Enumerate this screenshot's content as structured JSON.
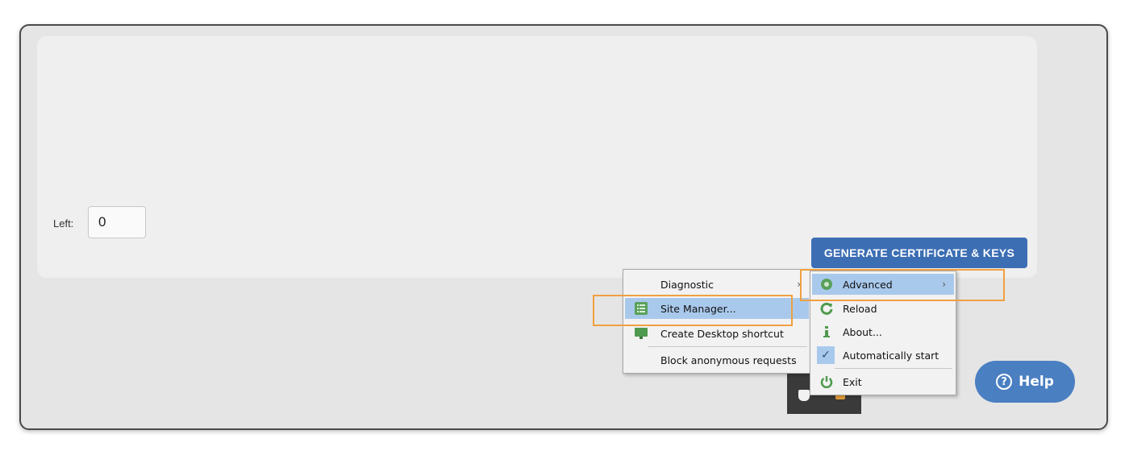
{
  "form": {
    "left_label": "Left:",
    "left_value": "0",
    "generate_button": "GENERATE CERTIFICATE & KEYS"
  },
  "help_button": {
    "icon": "question-circle-icon",
    "label": "Help"
  },
  "context_menu": {
    "items": [
      {
        "label": "Diagnostic",
        "has_submenu": true
      },
      {
        "label": "Site Manager...",
        "icon": "list-icon",
        "highlighted": true
      },
      {
        "label": "Create Desktop shortcut",
        "icon": "monitor-icon"
      },
      {
        "label": "Block anonymous requests"
      }
    ]
  },
  "submenu": {
    "items": [
      {
        "label": "Advanced",
        "icon": "gear-icon",
        "highlighted": true,
        "has_submenu": true
      },
      {
        "label": "Reload",
        "icon": "refresh-icon"
      },
      {
        "label": "About...",
        "icon": "info-icon"
      },
      {
        "label": "Automatically start",
        "icon": "checkmark-icon",
        "checked": true
      },
      {
        "label": "Exit",
        "icon": "power-icon"
      }
    ]
  },
  "colors": {
    "primary_button": "#3c6eb4",
    "help_button": "#4a7fc1",
    "menu_highlight": "#a9c9ec",
    "annotation_box": "#f0a040"
  }
}
